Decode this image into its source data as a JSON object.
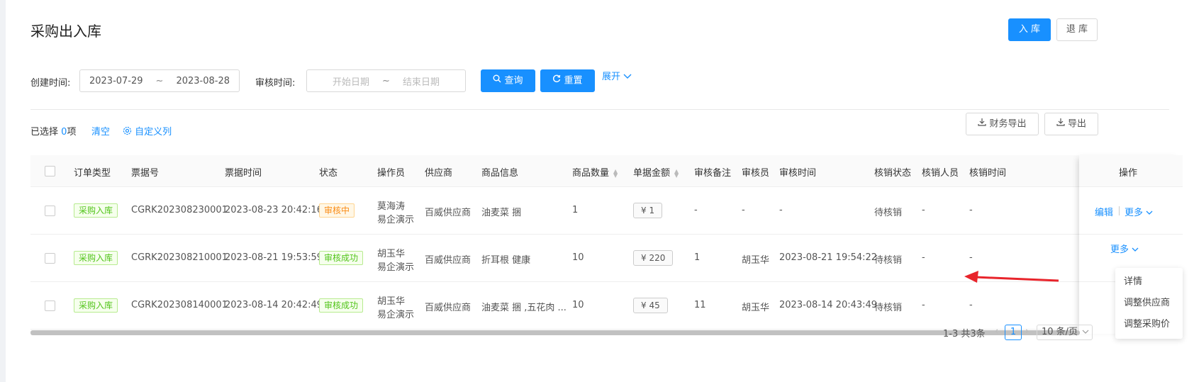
{
  "page": {
    "title": "采购出入库"
  },
  "actions": {
    "inbound": "入 库",
    "return": "退 库"
  },
  "filters": {
    "created_label": "创建时间:",
    "created_start": "2023-07-29",
    "created_end": "2023-08-28",
    "audit_label": "审核时间:",
    "audit_start_placeholder": "开始日期",
    "audit_end_placeholder": "结束日期",
    "range_sep": "~",
    "query": "查询",
    "reset": "重置",
    "expand": "展开"
  },
  "toolbar": {
    "selected_prefix": "已选择",
    "selected_count": "0",
    "selected_suffix": "项",
    "clear": "清空",
    "custom_columns": "自定义列",
    "finance_export": "财务导出",
    "export": "导出"
  },
  "table": {
    "columns": [
      "订单类型",
      "票据号",
      "票据时间",
      "状态",
      "操作员",
      "供应商",
      "商品信息",
      "商品数量",
      "单据金额",
      "审核备注",
      "审核员",
      "审核时间",
      "核销状态",
      "核销人员",
      "核销时间",
      "操作"
    ],
    "rows": [
      {
        "type": "采购入库",
        "bill_no": "CGRK202308230001",
        "bill_time": "2023-08-23 20:42:16",
        "status": "审核中",
        "operator1": "莫海涛",
        "operator2": "易企演示",
        "supplier": "百威供应商",
        "goods": "油麦菜 捆",
        "qty": "1",
        "amount": "¥ 1",
        "audit_note": "-",
        "auditor": "-",
        "audit_time": "-",
        "writeoff_status": "待核销",
        "writeoff_person": "-",
        "writeoff_time": "-"
      },
      {
        "type": "采购入库",
        "bill_no": "CGRK202308210001",
        "bill_time": "2023-08-21 19:53:59",
        "status": "审核成功",
        "operator1": "胡玉华",
        "operator2": "易企演示",
        "supplier": "百威供应商",
        "goods": "折耳根 健康",
        "qty": "10",
        "amount": "¥ 220",
        "audit_note": "1",
        "auditor": "胡玉华",
        "audit_time": "2023-08-21 19:54:22",
        "writeoff_status": "待核销",
        "writeoff_person": "-",
        "writeoff_time": "-"
      },
      {
        "type": "采购入库",
        "bill_no": "CGRK202308140001",
        "bill_time": "2023-08-14 20:42:49",
        "status": "审核成功",
        "operator1": "胡玉华",
        "operator2": "易企演示",
        "supplier": "百威供应商",
        "goods": "油麦菜 捆 ,五花肉 ...",
        "qty": "10",
        "amount": "¥ 45",
        "audit_note": "11",
        "auditor": "胡玉华",
        "audit_time": "2023-08-14 20:43:49",
        "writeoff_status": "待核销",
        "writeoff_person": "-",
        "writeoff_time": "-"
      }
    ],
    "row_actions": {
      "edit": "编辑",
      "more": "更多"
    }
  },
  "more_menu": {
    "items": [
      "详情",
      "调整供应商",
      "调整采购价"
    ]
  },
  "pagination": {
    "summary": "1-3 共3条",
    "current": "1",
    "page_size": "10 条/页"
  },
  "colors": {
    "primary": "#1890ff",
    "success": "#52c41a",
    "warning": "#fa8c16",
    "annotation_arrow": "#e8242b"
  }
}
